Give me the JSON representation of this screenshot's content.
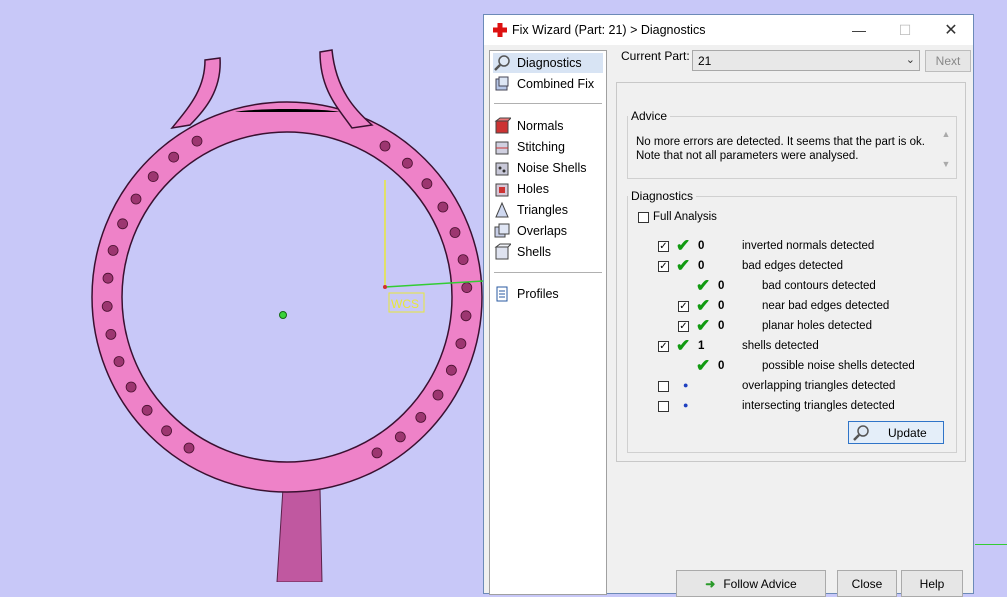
{
  "viewport": {
    "wcs_label": "WCS",
    "colors": {
      "background": "#c8c8f8",
      "ring": "#ee82c8",
      "gem": "#9c3670",
      "stem": "#c058a0"
    }
  },
  "dialog": {
    "title": "Fix Wizard (Part: 21) > Diagnostics",
    "title_icon": "red-cross-icon",
    "window_buttons": {
      "minimize": "—",
      "maximize": "☐",
      "close": "✕"
    }
  },
  "nav": {
    "items": [
      {
        "label": "Diagnostics",
        "icon": "magnifier-icon"
      },
      {
        "label": "Combined Fix",
        "icon": "cube-stack-icon"
      },
      {
        "label": "Normals",
        "icon": "cube-red-icon"
      },
      {
        "label": "Stitching",
        "icon": "cube-stitch-icon"
      },
      {
        "label": "Noise Shells",
        "icon": "cube-noise-icon"
      },
      {
        "label": "Holes",
        "icon": "cube-hole-icon"
      },
      {
        "label": "Triangles",
        "icon": "triangle-icon"
      },
      {
        "label": "Overlaps",
        "icon": "cube-overlap-icon"
      },
      {
        "label": "Shells",
        "icon": "cube-shell-icon"
      },
      {
        "label": "Profiles",
        "icon": "document-icon"
      }
    ]
  },
  "current_part": {
    "label": "Current Part:",
    "value": "21"
  },
  "next_label": "Next",
  "advice": {
    "legend": "Advice",
    "text": "No more errors are detected. It seems that the part is ok. Note that not all parameters were analysed."
  },
  "diagnostics": {
    "legend": "Diagnostics",
    "full_analysis": "Full Analysis",
    "rows": [
      {
        "count": "0",
        "label": "inverted normals detected"
      },
      {
        "count": "0",
        "label": "bad edges detected"
      },
      {
        "count": "0",
        "label": "bad contours detected"
      },
      {
        "count": "0",
        "label": "near bad edges detected"
      },
      {
        "count": "0",
        "label": "planar holes detected"
      },
      {
        "count": "1",
        "label": "shells detected"
      },
      {
        "count": "0",
        "label": "possible noise shells detected"
      },
      {
        "count": "",
        "label": "overlapping triangles detected"
      },
      {
        "count": "",
        "label": "intersecting triangles detected"
      }
    ],
    "update_label": "Update"
  },
  "buttons": {
    "follow_advice": "Follow Advice",
    "close": "Close",
    "help": "Help"
  }
}
